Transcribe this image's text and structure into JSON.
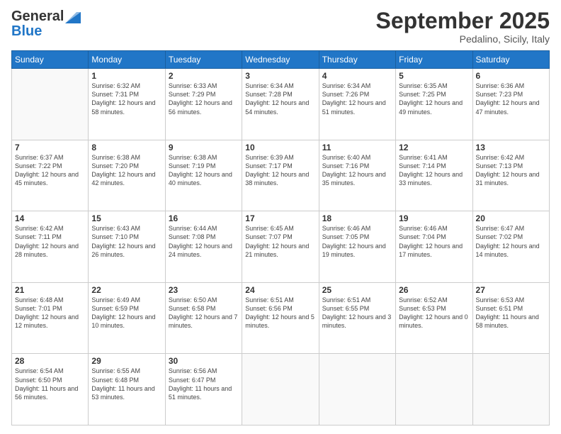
{
  "header": {
    "logo_general": "General",
    "logo_blue": "Blue",
    "month_title": "September 2025",
    "location": "Pedalino, Sicily, Italy"
  },
  "days_of_week": [
    "Sunday",
    "Monday",
    "Tuesday",
    "Wednesday",
    "Thursday",
    "Friday",
    "Saturday"
  ],
  "weeks": [
    [
      {
        "day": "",
        "sunrise": "",
        "sunset": "",
        "daylight": ""
      },
      {
        "day": "1",
        "sunrise": "Sunrise: 6:32 AM",
        "sunset": "Sunset: 7:31 PM",
        "daylight": "Daylight: 12 hours and 58 minutes."
      },
      {
        "day": "2",
        "sunrise": "Sunrise: 6:33 AM",
        "sunset": "Sunset: 7:29 PM",
        "daylight": "Daylight: 12 hours and 56 minutes."
      },
      {
        "day": "3",
        "sunrise": "Sunrise: 6:34 AM",
        "sunset": "Sunset: 7:28 PM",
        "daylight": "Daylight: 12 hours and 54 minutes."
      },
      {
        "day": "4",
        "sunrise": "Sunrise: 6:34 AM",
        "sunset": "Sunset: 7:26 PM",
        "daylight": "Daylight: 12 hours and 51 minutes."
      },
      {
        "day": "5",
        "sunrise": "Sunrise: 6:35 AM",
        "sunset": "Sunset: 7:25 PM",
        "daylight": "Daylight: 12 hours and 49 minutes."
      },
      {
        "day": "6",
        "sunrise": "Sunrise: 6:36 AM",
        "sunset": "Sunset: 7:23 PM",
        "daylight": "Daylight: 12 hours and 47 minutes."
      }
    ],
    [
      {
        "day": "7",
        "sunrise": "Sunrise: 6:37 AM",
        "sunset": "Sunset: 7:22 PM",
        "daylight": "Daylight: 12 hours and 45 minutes."
      },
      {
        "day": "8",
        "sunrise": "Sunrise: 6:38 AM",
        "sunset": "Sunset: 7:20 PM",
        "daylight": "Daylight: 12 hours and 42 minutes."
      },
      {
        "day": "9",
        "sunrise": "Sunrise: 6:38 AM",
        "sunset": "Sunset: 7:19 PM",
        "daylight": "Daylight: 12 hours and 40 minutes."
      },
      {
        "day": "10",
        "sunrise": "Sunrise: 6:39 AM",
        "sunset": "Sunset: 7:17 PM",
        "daylight": "Daylight: 12 hours and 38 minutes."
      },
      {
        "day": "11",
        "sunrise": "Sunrise: 6:40 AM",
        "sunset": "Sunset: 7:16 PM",
        "daylight": "Daylight: 12 hours and 35 minutes."
      },
      {
        "day": "12",
        "sunrise": "Sunrise: 6:41 AM",
        "sunset": "Sunset: 7:14 PM",
        "daylight": "Daylight: 12 hours and 33 minutes."
      },
      {
        "day": "13",
        "sunrise": "Sunrise: 6:42 AM",
        "sunset": "Sunset: 7:13 PM",
        "daylight": "Daylight: 12 hours and 31 minutes."
      }
    ],
    [
      {
        "day": "14",
        "sunrise": "Sunrise: 6:42 AM",
        "sunset": "Sunset: 7:11 PM",
        "daylight": "Daylight: 12 hours and 28 minutes."
      },
      {
        "day": "15",
        "sunrise": "Sunrise: 6:43 AM",
        "sunset": "Sunset: 7:10 PM",
        "daylight": "Daylight: 12 hours and 26 minutes."
      },
      {
        "day": "16",
        "sunrise": "Sunrise: 6:44 AM",
        "sunset": "Sunset: 7:08 PM",
        "daylight": "Daylight: 12 hours and 24 minutes."
      },
      {
        "day": "17",
        "sunrise": "Sunrise: 6:45 AM",
        "sunset": "Sunset: 7:07 PM",
        "daylight": "Daylight: 12 hours and 21 minutes."
      },
      {
        "day": "18",
        "sunrise": "Sunrise: 6:46 AM",
        "sunset": "Sunset: 7:05 PM",
        "daylight": "Daylight: 12 hours and 19 minutes."
      },
      {
        "day": "19",
        "sunrise": "Sunrise: 6:46 AM",
        "sunset": "Sunset: 7:04 PM",
        "daylight": "Daylight: 12 hours and 17 minutes."
      },
      {
        "day": "20",
        "sunrise": "Sunrise: 6:47 AM",
        "sunset": "Sunset: 7:02 PM",
        "daylight": "Daylight: 12 hours and 14 minutes."
      }
    ],
    [
      {
        "day": "21",
        "sunrise": "Sunrise: 6:48 AM",
        "sunset": "Sunset: 7:01 PM",
        "daylight": "Daylight: 12 hours and 12 minutes."
      },
      {
        "day": "22",
        "sunrise": "Sunrise: 6:49 AM",
        "sunset": "Sunset: 6:59 PM",
        "daylight": "Daylight: 12 hours and 10 minutes."
      },
      {
        "day": "23",
        "sunrise": "Sunrise: 6:50 AM",
        "sunset": "Sunset: 6:58 PM",
        "daylight": "Daylight: 12 hours and 7 minutes."
      },
      {
        "day": "24",
        "sunrise": "Sunrise: 6:51 AM",
        "sunset": "Sunset: 6:56 PM",
        "daylight": "Daylight: 12 hours and 5 minutes."
      },
      {
        "day": "25",
        "sunrise": "Sunrise: 6:51 AM",
        "sunset": "Sunset: 6:55 PM",
        "daylight": "Daylight: 12 hours and 3 minutes."
      },
      {
        "day": "26",
        "sunrise": "Sunrise: 6:52 AM",
        "sunset": "Sunset: 6:53 PM",
        "daylight": "Daylight: 12 hours and 0 minutes."
      },
      {
        "day": "27",
        "sunrise": "Sunrise: 6:53 AM",
        "sunset": "Sunset: 6:51 PM",
        "daylight": "Daylight: 11 hours and 58 minutes."
      }
    ],
    [
      {
        "day": "28",
        "sunrise": "Sunrise: 6:54 AM",
        "sunset": "Sunset: 6:50 PM",
        "daylight": "Daylight: 11 hours and 56 minutes."
      },
      {
        "day": "29",
        "sunrise": "Sunrise: 6:55 AM",
        "sunset": "Sunset: 6:48 PM",
        "daylight": "Daylight: 11 hours and 53 minutes."
      },
      {
        "day": "30",
        "sunrise": "Sunrise: 6:56 AM",
        "sunset": "Sunset: 6:47 PM",
        "daylight": "Daylight: 11 hours and 51 minutes."
      },
      {
        "day": "",
        "sunrise": "",
        "sunset": "",
        "daylight": ""
      },
      {
        "day": "",
        "sunrise": "",
        "sunset": "",
        "daylight": ""
      },
      {
        "day": "",
        "sunrise": "",
        "sunset": "",
        "daylight": ""
      },
      {
        "day": "",
        "sunrise": "",
        "sunset": "",
        "daylight": ""
      }
    ]
  ]
}
